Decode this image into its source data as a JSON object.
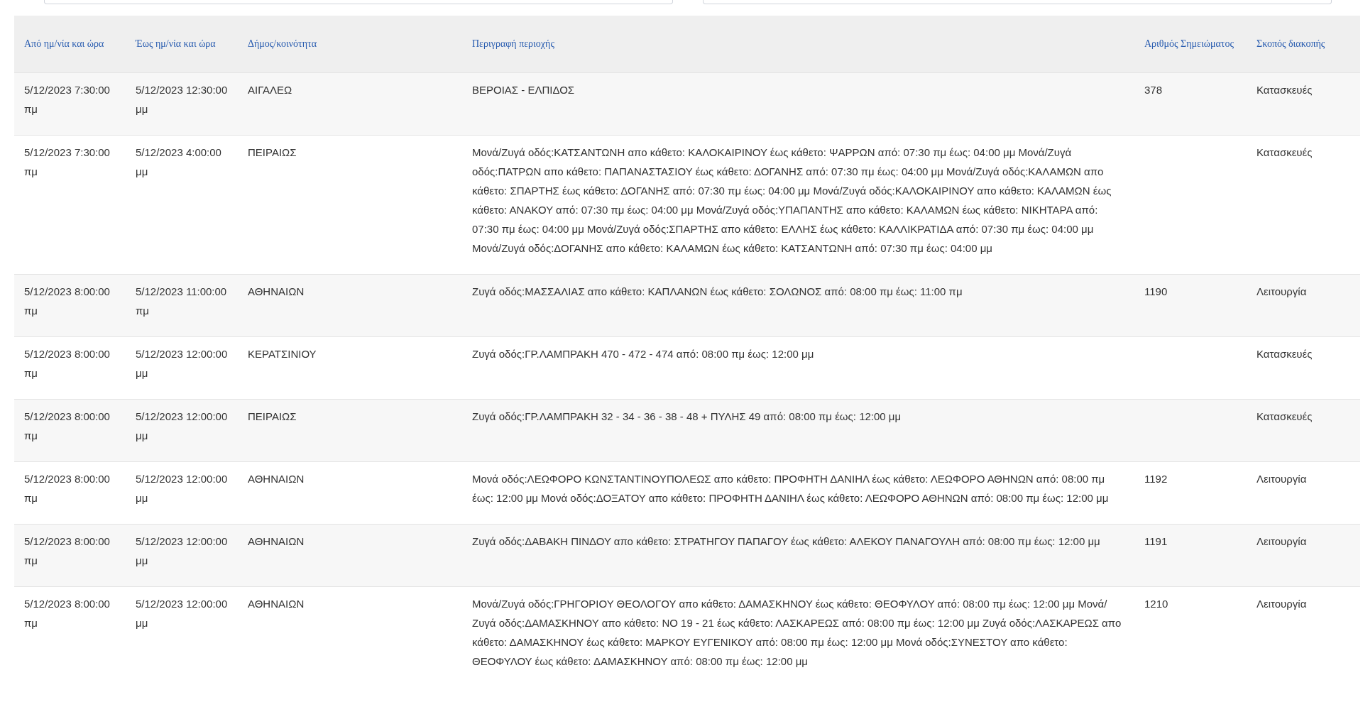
{
  "table": {
    "columns": [
      "Από ημ/νία και ώρα",
      "Έως ημ/νία και ώρα",
      "Δήμος/κοινότητα",
      "Περιγραφή περιοχής",
      "Αριθμός Σημειώματος",
      "Σκοπός διακοπής"
    ],
    "rows": [
      {
        "from": "5/12/2023 7:30:00 πμ",
        "to": "5/12/2023 12:30:00 μμ",
        "municipality": "ΑΙΓΑΛΕΩ",
        "description": "ΒΕΡΟΙΑΣ - ΕΛΠΙΔΟΣ",
        "note_number": "378",
        "purpose": "Κατασκευές"
      },
      {
        "from": "5/12/2023 7:30:00 πμ",
        "to": "5/12/2023 4:00:00 μμ",
        "municipality": "ΠΕΙΡΑΙΩΣ",
        "description": "Μονά/Ζυγά οδός:ΚΑΤΣΑΝΤΩΝΗ απο κάθετο: ΚΑΛΟΚΑΙΡΙΝΟΥ έως κάθετο: ΨΑΡΡΩΝ από: 07:30 πμ έως: 04:00 μμ Μονά/Ζυγά οδός:ΠΑΤΡΩΝ απο κάθετο: ΠΑΠΑΝΑΣΤΑΣΙΟΥ έως κάθετο: ΔΟΓΑΝΗΣ από: 07:30 πμ έως: 04:00 μμ Μονά/Ζυγά οδός:ΚΑΛΑΜΩΝ απο κάθετο: ΣΠΑΡΤΗΣ έως κάθετο: ΔΟΓΑΝΗΣ από: 07:30 πμ έως: 04:00 μμ Μονά/Ζυγά οδός:ΚΑΛΟΚΑΙΡΙΝΟΥ απο κάθετο: ΚΑΛΑΜΩΝ έως κάθετο: ΑΝΑΚΟΥ από: 07:30 πμ έως: 04:00 μμ Μονά/Ζυγά οδός:ΥΠΑΠΑΝΤΗΣ απο κάθετο: ΚΑΛΑΜΩΝ έως κάθετο: ΝΙΚΗΤΑΡΑ από: 07:30 πμ έως: 04:00 μμ Μονά/Ζυγά οδός:ΣΠΑΡΤΗΣ απο κάθετο: ΕΛΛΗΣ έως κάθετο: ΚΑΛΛΙΚΡΑΤΙΔΑ από: 07:30 πμ έως: 04:00 μμ Μονά/Ζυγά οδός:ΔΟΓΑΝΗΣ απο κάθετο: ΚΑΛΑΜΩΝ έως κάθετο: ΚΑΤΣΑΝΤΩΝΗ από: 07:30 πμ έως: 04:00 μμ",
        "note_number": "",
        "purpose": "Κατασκευές"
      },
      {
        "from": "5/12/2023 8:00:00 πμ",
        "to": "5/12/2023 11:00:00 πμ",
        "municipality": "ΑΘΗΝΑΙΩΝ",
        "description": "Ζυγά οδός:ΜΑΣΣΑΛΙΑΣ απο κάθετο: ΚΑΠΛΑΝΩΝ έως κάθετο: ΣΟΛΩΝΟΣ από: 08:00 πμ έως: 11:00 πμ",
        "note_number": "1190",
        "purpose": "Λειτουργία"
      },
      {
        "from": "5/12/2023 8:00:00 πμ",
        "to": "5/12/2023 12:00:00 μμ",
        "municipality": "ΚΕΡΑΤΣΙΝΙΟΥ",
        "description": "Ζυγά οδός:ΓΡ.ΛΑΜΠΡΑΚΗ 470 - 472 - 474 από: 08:00 πμ έως: 12:00 μμ",
        "note_number": "",
        "purpose": "Κατασκευές"
      },
      {
        "from": "5/12/2023 8:00:00 πμ",
        "to": "5/12/2023 12:00:00 μμ",
        "municipality": "ΠΕΙΡΑΙΩΣ",
        "description": "Ζυγά οδός:ΓΡ.ΛΑΜΠΡΑΚΗ 32 - 34 - 36 - 38 - 48 + ΠΥΛΗΣ 49 από: 08:00 πμ έως: 12:00 μμ",
        "note_number": "",
        "purpose": "Κατασκευές"
      },
      {
        "from": "5/12/2023 8:00:00 πμ",
        "to": "5/12/2023 12:00:00 μμ",
        "municipality": "ΑΘΗΝΑΙΩΝ",
        "description": "Μονά οδός:ΛΕΩΦΟΡΟ ΚΩΝΣΤΑΝΤΙΝΟΥΠΟΛΕΩΣ απο κάθετο: ΠΡΟΦΗΤΗ ΔΑΝΙΗΛ έως κάθετο: ΛΕΩΦΟΡΟ ΑΘΗΝΩΝ από: 08:00 πμ έως: 12:00 μμ Μονά οδός:ΔΟΞΑΤΟΥ απο κάθετο: ΠΡΟΦΗΤΗ ΔΑΝΙΗΛ έως κάθετο: ΛΕΩΦΟΡΟ ΑΘΗΝΩΝ από: 08:00 πμ έως: 12:00 μμ",
        "note_number": "1192",
        "purpose": "Λειτουργία"
      },
      {
        "from": "5/12/2023 8:00:00 πμ",
        "to": "5/12/2023 12:00:00 μμ",
        "municipality": "ΑΘΗΝΑΙΩΝ",
        "description": "Ζυγά οδός:ΔΑΒΑΚΗ ΠΙΝΔΟΥ απο κάθετο: ΣΤΡΑΤΗΓΟΥ ΠΑΠΑΓΟΥ έως κάθετο: ΑΛΕΚΟΥ ΠΑΝΑΓΟΥΛΗ από: 08:00 πμ έως: 12:00 μμ",
        "note_number": "1191",
        "purpose": "Λειτουργία"
      },
      {
        "from": "5/12/2023 8:00:00 πμ",
        "to": "5/12/2023 12:00:00 μμ",
        "municipality": "ΑΘΗΝΑΙΩΝ",
        "description": "Μονά/Ζυγά οδός:ΓΡΗΓΟΡΙΟΥ ΘΕΟΛΟΓΟΥ απο κάθετο: ΔΑΜΑΣΚΗΝΟΥ έως κάθετο: ΘΕΟΦΥΛΟΥ από: 08:00 πμ έως: 12:00 μμ Μονά/Ζυγά οδός:ΔΑΜΑΣΚΗΝΟΥ απο κάθετο: ΝΟ 19 - 21 έως κάθετο: ΛΑΣΚΑΡΕΩΣ από: 08:00 πμ έως: 12:00 μμ Ζυγά οδός:ΛΑΣΚΑΡΕΩΣ απο κάθετο: ΔΑΜΑΣΚΗΝΟΥ έως κάθετο: ΜΑΡΚΟΥ ΕΥΓΕΝΙΚΟΥ από: 08:00 πμ έως: 12:00 μμ Μονά οδός:ΣΥΝΕΣΤΟΥ απο κάθετο: ΘΕΟΦΥΛΟΥ έως κάθετο: ΔΑΜΑΣΚΗΝΟΥ από: 08:00 πμ έως: 12:00 μμ",
        "note_number": "1210",
        "purpose": "Λειτουργία"
      }
    ]
  }
}
